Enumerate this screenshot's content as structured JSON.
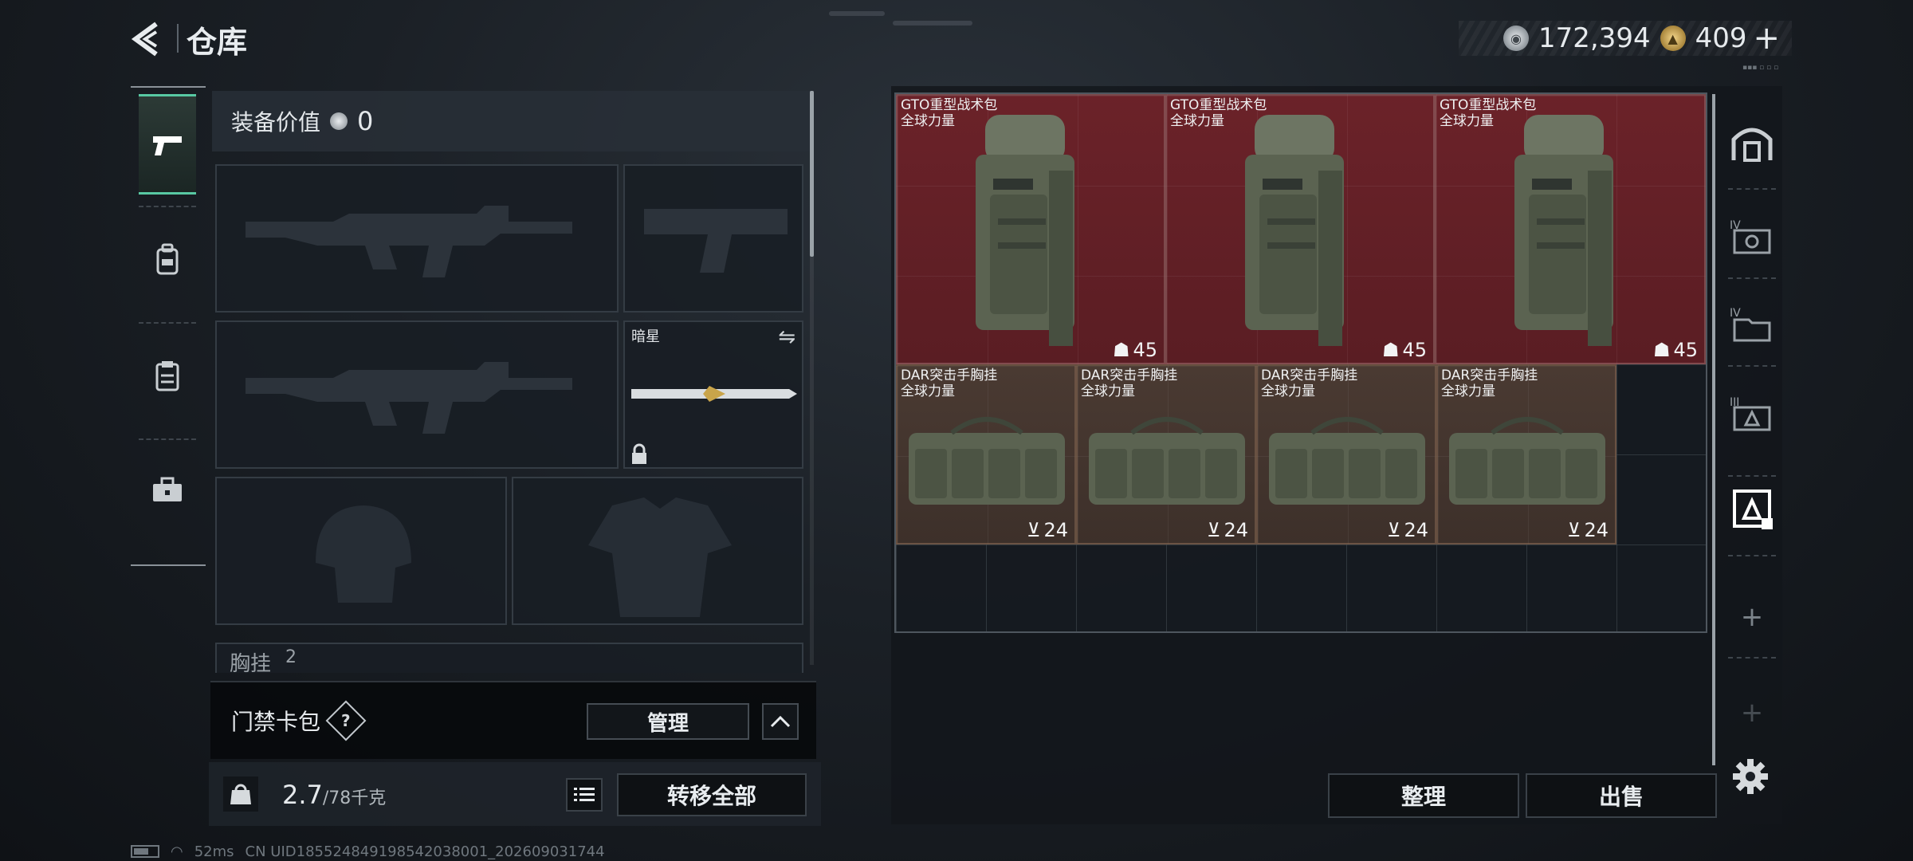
{
  "header": {
    "back_icon": "back-arrow-icon",
    "title": "仓库",
    "currency": {
      "silver_value": "172,394",
      "gold_value": "409",
      "add_label": "+",
      "version_text": "▪▪▪ ▫ ▫ ▫"
    }
  },
  "left_rail": {
    "items": [
      {
        "icon": "pistol-icon",
        "active": true
      },
      {
        "icon": "backpack-icon",
        "active": false
      },
      {
        "icon": "clipboard-icon",
        "active": false
      },
      {
        "icon": "toolbox-icon",
        "active": false
      }
    ]
  },
  "loadout": {
    "equip_value_label": "装备价值",
    "equip_value": "0",
    "melee_name": "暗星",
    "chest_label": "胸挂",
    "chest_count": "2"
  },
  "keycard": {
    "label": "门禁卡包",
    "help": "?",
    "manage_label": "管理"
  },
  "weight": {
    "current": "2.7",
    "max": "/78千克",
    "transfer_label": "转移全部"
  },
  "status": {
    "ping": "52ms",
    "uid": "CN UID1855248491985420380​01_202609031744"
  },
  "stash": {
    "items": [
      {
        "name": "GTO重型战术包",
        "sub": "全球力量",
        "capacity": "45",
        "kind": "backpack"
      },
      {
        "name": "GTO重型战术包",
        "sub": "全球力量",
        "capacity": "45",
        "kind": "backpack"
      },
      {
        "name": "GTO重型战术包",
        "sub": "全球力量",
        "capacity": "45",
        "kind": "backpack"
      },
      {
        "name": "DAR突击手胸挂",
        "sub": "全球力量",
        "capacity": "24",
        "kind": "rig"
      },
      {
        "name": "DAR突击手胸挂",
        "sub": "全球力量",
        "capacity": "24",
        "kind": "rig"
      },
      {
        "name": "DAR突击手胸挂",
        "sub": "全球力量",
        "capacity": "24",
        "kind": "rig"
      },
      {
        "name": "DAR突击手胸挂",
        "sub": "全球力量",
        "capacity": "24",
        "kind": "rig"
      }
    ],
    "sort_label": "整理",
    "sell_label": "出售"
  },
  "right_rail": {
    "items": [
      {
        "icon": "safe-box-icon",
        "label": ""
      },
      {
        "icon": "storage-tier-iv-icon",
        "label": "IV"
      },
      {
        "icon": "storage-folder-iv-icon",
        "label": "IV"
      },
      {
        "icon": "storage-tier-iii-icon",
        "label": "III"
      },
      {
        "icon": "storage-selected-icon",
        "label": ""
      }
    ],
    "add_label": "+"
  },
  "colors": {
    "accent_green": "#58c9a3",
    "backpack_bg": "#6b2229",
    "rig_bg": "#4a3a32"
  }
}
